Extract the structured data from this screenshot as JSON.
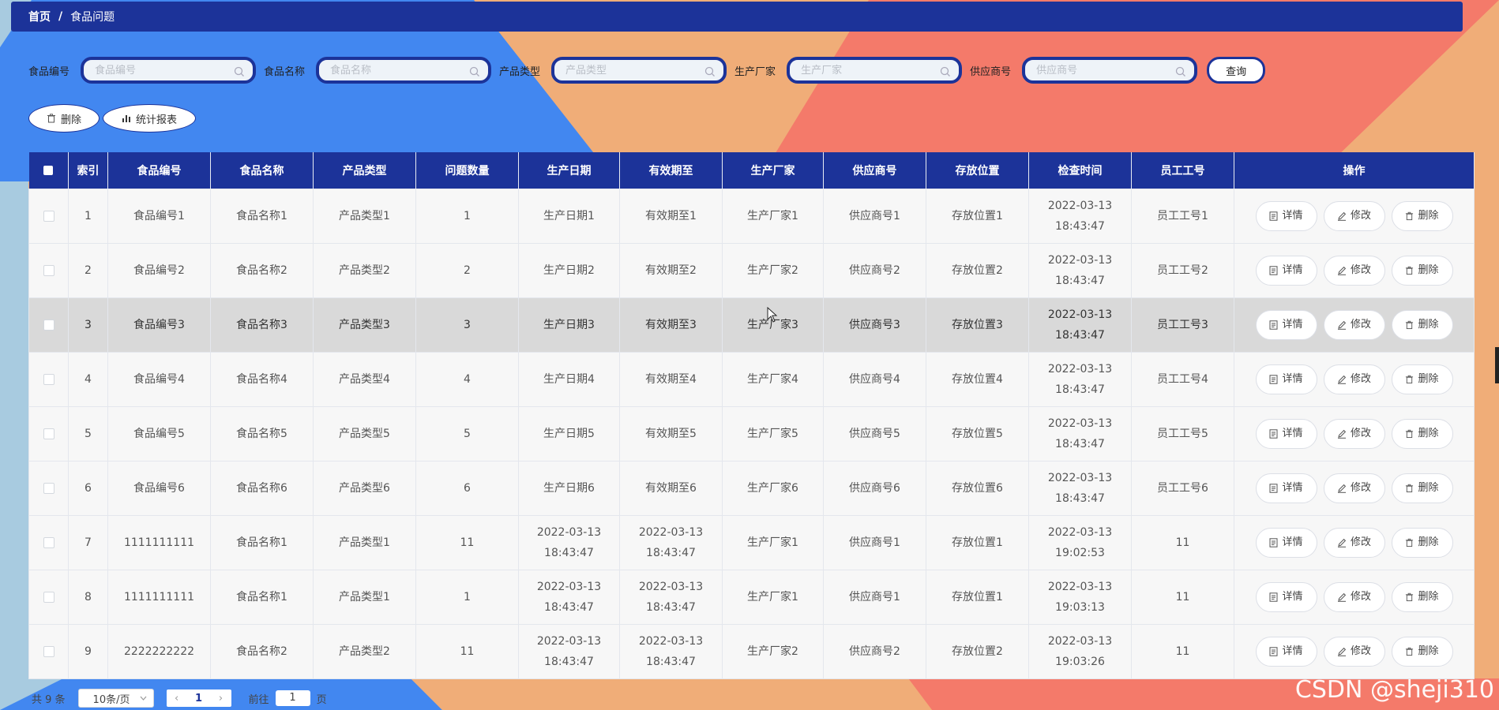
{
  "breadcrumb": {
    "home": "首页",
    "separator": "/",
    "current": "食品问题"
  },
  "search": {
    "fields": [
      {
        "label": "食品编号",
        "placeholder": "食品编号"
      },
      {
        "label": "食品名称",
        "placeholder": "食品名称"
      },
      {
        "label": "产品类型",
        "placeholder": "产品类型"
      },
      {
        "label": "生产厂家",
        "placeholder": "生产厂家"
      },
      {
        "label": "供应商号",
        "placeholder": "供应商号"
      }
    ],
    "query_label": "查询"
  },
  "actions": {
    "delete_label": "删除",
    "report_label": "统计报表"
  },
  "table": {
    "headers": [
      "",
      "索引",
      "食品编号",
      "食品名称",
      "产品类型",
      "问题数量",
      "生产日期",
      "有效期至",
      "生产厂家",
      "供应商号",
      "存放位置",
      "检查时间",
      "员工工号",
      "操作"
    ],
    "rows": [
      {
        "index": "1",
        "food_no": "食品编号1",
        "food_name": "食品名称1",
        "type": "产品类型1",
        "qty": "1",
        "prod_date": "生产日期1",
        "valid_until": "有效期至1",
        "maker": "生产厂家1",
        "supplier": "供应商号1",
        "location": "存放位置1",
        "check_time": "2022-03-13 18:43:47",
        "staff_no": "员工工号1"
      },
      {
        "index": "2",
        "food_no": "食品编号2",
        "food_name": "食品名称2",
        "type": "产品类型2",
        "qty": "2",
        "prod_date": "生产日期2",
        "valid_until": "有效期至2",
        "maker": "生产厂家2",
        "supplier": "供应商号2",
        "location": "存放位置2",
        "check_time": "2022-03-13 18:43:47",
        "staff_no": "员工工号2"
      },
      {
        "index": "3",
        "food_no": "食品编号3",
        "food_name": "食品名称3",
        "type": "产品类型3",
        "qty": "3",
        "prod_date": "生产日期3",
        "valid_until": "有效期至3",
        "maker": "生产厂家3",
        "supplier": "供应商号3",
        "location": "存放位置3",
        "check_time": "2022-03-13 18:43:47",
        "staff_no": "员工工号3"
      },
      {
        "index": "4",
        "food_no": "食品编号4",
        "food_name": "食品名称4",
        "type": "产品类型4",
        "qty": "4",
        "prod_date": "生产日期4",
        "valid_until": "有效期至4",
        "maker": "生产厂家4",
        "supplier": "供应商号4",
        "location": "存放位置4",
        "check_time": "2022-03-13 18:43:47",
        "staff_no": "员工工号4"
      },
      {
        "index": "5",
        "food_no": "食品编号5",
        "food_name": "食品名称5",
        "type": "产品类型5",
        "qty": "5",
        "prod_date": "生产日期5",
        "valid_until": "有效期至5",
        "maker": "生产厂家5",
        "supplier": "供应商号5",
        "location": "存放位置5",
        "check_time": "2022-03-13 18:43:47",
        "staff_no": "员工工号5"
      },
      {
        "index": "6",
        "food_no": "食品编号6",
        "food_name": "食品名称6",
        "type": "产品类型6",
        "qty": "6",
        "prod_date": "生产日期6",
        "valid_until": "有效期至6",
        "maker": "生产厂家6",
        "supplier": "供应商号6",
        "location": "存放位置6",
        "check_time": "2022-03-13 18:43:47",
        "staff_no": "员工工号6"
      },
      {
        "index": "7",
        "food_no": "1111111111",
        "food_name": "食品名称1",
        "type": "产品类型1",
        "qty": "11",
        "prod_date": "2022-03-13 18:43:47",
        "valid_until": "2022-03-13 18:43:47",
        "maker": "生产厂家1",
        "supplier": "供应商号1",
        "location": "存放位置1",
        "check_time": "2022-03-13 19:02:53",
        "staff_no": "11"
      },
      {
        "index": "8",
        "food_no": "1111111111",
        "food_name": "食品名称1",
        "type": "产品类型1",
        "qty": "1",
        "prod_date": "2022-03-13 18:43:47",
        "valid_until": "2022-03-13 18:43:47",
        "maker": "生产厂家1",
        "supplier": "供应商号1",
        "location": "存放位置1",
        "check_time": "2022-03-13 19:03:13",
        "staff_no": "11"
      },
      {
        "index": "9",
        "food_no": "2222222222",
        "food_name": "食品名称2",
        "type": "产品类型2",
        "qty": "11",
        "prod_date": "2022-03-13 18:43:47",
        "valid_until": "2022-03-13 18:43:47",
        "maker": "生产厂家2",
        "supplier": "供应商号2",
        "location": "存放位置2",
        "check_time": "2022-03-13 19:03:26",
        "staff_no": "11"
      }
    ],
    "row_actions": {
      "detail": "详情",
      "edit": "修改",
      "delete": "删除"
    },
    "highlighted_row_index": "3"
  },
  "pagination": {
    "total": "共 9 条",
    "page_size": "10条/页",
    "current_page": "1",
    "goto_prefix": "前往",
    "goto_value": "1",
    "goto_suffix": "页"
  },
  "watermark": "CSDN @sheji310",
  "colors": {
    "primary": "#1c3399",
    "bg_blue": "#4287f0",
    "bg_orange": "#f0ad78",
    "bg_coral": "#f47a6a",
    "bg_lightblue": "#a8cbe0"
  }
}
